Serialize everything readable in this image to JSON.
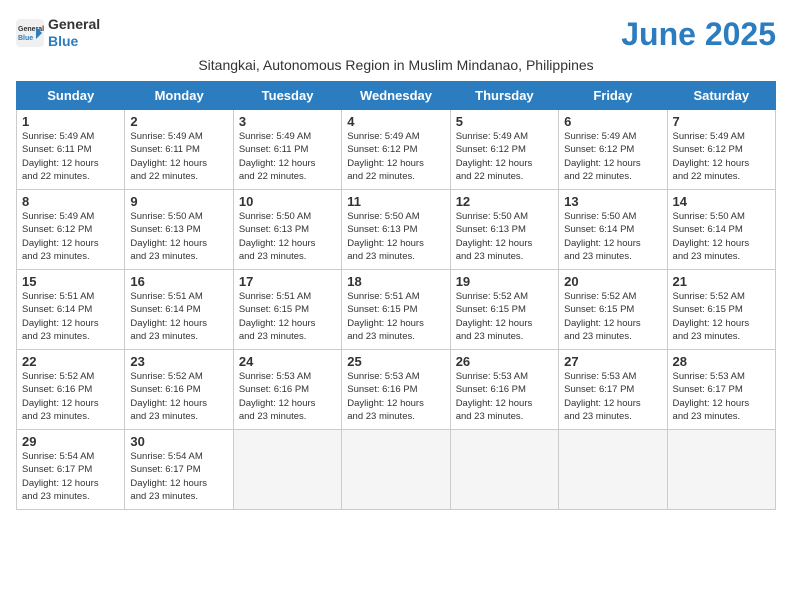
{
  "logo": {
    "line1": "General",
    "line2": "Blue"
  },
  "title": "June 2025",
  "subtitle": "Sitangkai, Autonomous Region in Muslim Mindanao, Philippines",
  "weekdays": [
    "Sunday",
    "Monday",
    "Tuesday",
    "Wednesday",
    "Thursday",
    "Friday",
    "Saturday"
  ],
  "weeks": [
    [
      {
        "day": "1",
        "info": "Sunrise: 5:49 AM\nSunset: 6:11 PM\nDaylight: 12 hours\nand 22 minutes."
      },
      {
        "day": "2",
        "info": "Sunrise: 5:49 AM\nSunset: 6:11 PM\nDaylight: 12 hours\nand 22 minutes."
      },
      {
        "day": "3",
        "info": "Sunrise: 5:49 AM\nSunset: 6:11 PM\nDaylight: 12 hours\nand 22 minutes."
      },
      {
        "day": "4",
        "info": "Sunrise: 5:49 AM\nSunset: 6:12 PM\nDaylight: 12 hours\nand 22 minutes."
      },
      {
        "day": "5",
        "info": "Sunrise: 5:49 AM\nSunset: 6:12 PM\nDaylight: 12 hours\nand 22 minutes."
      },
      {
        "day": "6",
        "info": "Sunrise: 5:49 AM\nSunset: 6:12 PM\nDaylight: 12 hours\nand 22 minutes."
      },
      {
        "day": "7",
        "info": "Sunrise: 5:49 AM\nSunset: 6:12 PM\nDaylight: 12 hours\nand 22 minutes."
      }
    ],
    [
      {
        "day": "8",
        "info": "Sunrise: 5:49 AM\nSunset: 6:12 PM\nDaylight: 12 hours\nand 23 minutes."
      },
      {
        "day": "9",
        "info": "Sunrise: 5:50 AM\nSunset: 6:13 PM\nDaylight: 12 hours\nand 23 minutes."
      },
      {
        "day": "10",
        "info": "Sunrise: 5:50 AM\nSunset: 6:13 PM\nDaylight: 12 hours\nand 23 minutes."
      },
      {
        "day": "11",
        "info": "Sunrise: 5:50 AM\nSunset: 6:13 PM\nDaylight: 12 hours\nand 23 minutes."
      },
      {
        "day": "12",
        "info": "Sunrise: 5:50 AM\nSunset: 6:13 PM\nDaylight: 12 hours\nand 23 minutes."
      },
      {
        "day": "13",
        "info": "Sunrise: 5:50 AM\nSunset: 6:14 PM\nDaylight: 12 hours\nand 23 minutes."
      },
      {
        "day": "14",
        "info": "Sunrise: 5:50 AM\nSunset: 6:14 PM\nDaylight: 12 hours\nand 23 minutes."
      }
    ],
    [
      {
        "day": "15",
        "info": "Sunrise: 5:51 AM\nSunset: 6:14 PM\nDaylight: 12 hours\nand 23 minutes."
      },
      {
        "day": "16",
        "info": "Sunrise: 5:51 AM\nSunset: 6:14 PM\nDaylight: 12 hours\nand 23 minutes."
      },
      {
        "day": "17",
        "info": "Sunrise: 5:51 AM\nSunset: 6:15 PM\nDaylight: 12 hours\nand 23 minutes."
      },
      {
        "day": "18",
        "info": "Sunrise: 5:51 AM\nSunset: 6:15 PM\nDaylight: 12 hours\nand 23 minutes."
      },
      {
        "day": "19",
        "info": "Sunrise: 5:52 AM\nSunset: 6:15 PM\nDaylight: 12 hours\nand 23 minutes."
      },
      {
        "day": "20",
        "info": "Sunrise: 5:52 AM\nSunset: 6:15 PM\nDaylight: 12 hours\nand 23 minutes."
      },
      {
        "day": "21",
        "info": "Sunrise: 5:52 AM\nSunset: 6:15 PM\nDaylight: 12 hours\nand 23 minutes."
      }
    ],
    [
      {
        "day": "22",
        "info": "Sunrise: 5:52 AM\nSunset: 6:16 PM\nDaylight: 12 hours\nand 23 minutes."
      },
      {
        "day": "23",
        "info": "Sunrise: 5:52 AM\nSunset: 6:16 PM\nDaylight: 12 hours\nand 23 minutes."
      },
      {
        "day": "24",
        "info": "Sunrise: 5:53 AM\nSunset: 6:16 PM\nDaylight: 12 hours\nand 23 minutes."
      },
      {
        "day": "25",
        "info": "Sunrise: 5:53 AM\nSunset: 6:16 PM\nDaylight: 12 hours\nand 23 minutes."
      },
      {
        "day": "26",
        "info": "Sunrise: 5:53 AM\nSunset: 6:16 PM\nDaylight: 12 hours\nand 23 minutes."
      },
      {
        "day": "27",
        "info": "Sunrise: 5:53 AM\nSunset: 6:17 PM\nDaylight: 12 hours\nand 23 minutes."
      },
      {
        "day": "28",
        "info": "Sunrise: 5:53 AM\nSunset: 6:17 PM\nDaylight: 12 hours\nand 23 minutes."
      }
    ],
    [
      {
        "day": "29",
        "info": "Sunrise: 5:54 AM\nSunset: 6:17 PM\nDaylight: 12 hours\nand 23 minutes."
      },
      {
        "day": "30",
        "info": "Sunrise: 5:54 AM\nSunset: 6:17 PM\nDaylight: 12 hours\nand 23 minutes."
      },
      {
        "day": "",
        "info": ""
      },
      {
        "day": "",
        "info": ""
      },
      {
        "day": "",
        "info": ""
      },
      {
        "day": "",
        "info": ""
      },
      {
        "day": "",
        "info": ""
      }
    ]
  ]
}
